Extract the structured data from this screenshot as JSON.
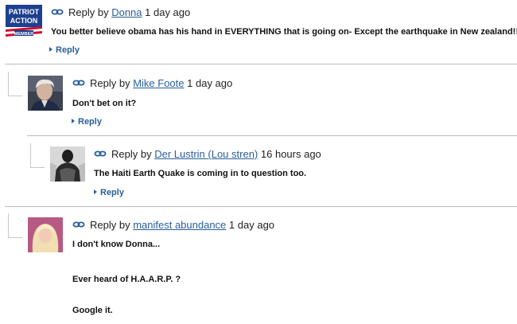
{
  "link_icon": "chain-link-icon",
  "colors": {
    "author_link": "#2a5e9a",
    "divider": "#bdbdbd"
  },
  "comments": [
    {
      "meta_prefix": "Reply by",
      "author": "Donna",
      "time": "1 day ago",
      "avatar": {
        "line1": "PATRIOT",
        "line2": "ACTION",
        "line3": "MEMBER"
      },
      "lines": [
        "You better believe obama has his hand in EVERYTHING that is going on- Except the earthquake in New zealand!!"
      ],
      "reply": "Reply"
    },
    {
      "meta_prefix": "Reply by",
      "author": "Mike Foote",
      "time": "1 day ago",
      "lines": [
        "Don't bet on it?"
      ],
      "reply": "Reply"
    },
    {
      "meta_prefix": "Reply by",
      "author": "Der Lustrin (Lou stren)",
      "time": "16 hours ago",
      "lines": [
        "The Haiti Earth Quake is coming in to question too."
      ],
      "reply": "Reply"
    },
    {
      "meta_prefix": "Reply by",
      "author": "manifest abundance",
      "time": "1 day ago",
      "lines": [
        "I don't know Donna...",
        "Ever heard of H.A.A.R.P. ?",
        "Google it."
      ]
    }
  ]
}
